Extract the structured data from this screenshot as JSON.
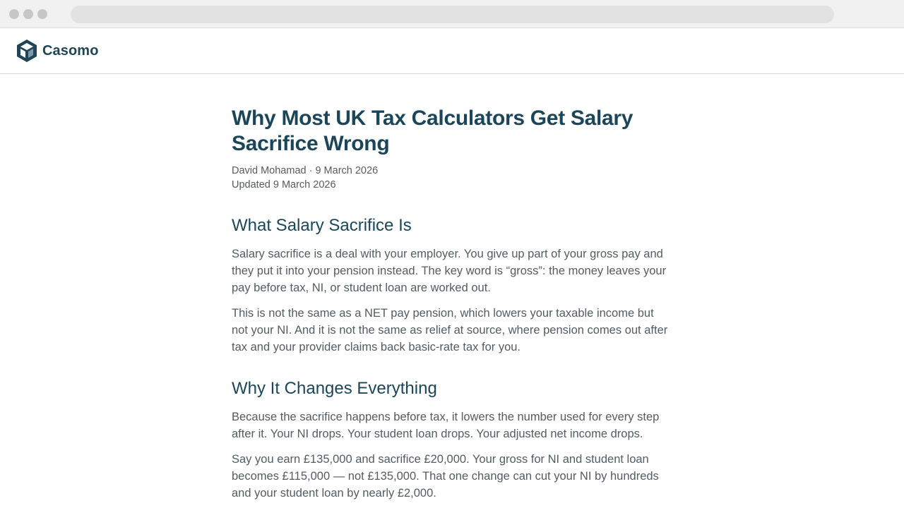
{
  "header": {
    "logo_text": "Casomo",
    "logo_icon": "cube-logo-icon",
    "brand_color": "#1f4556"
  },
  "article": {
    "title": "Why Most UK Tax Calculators Get Salary Sacrifice Wrong",
    "byline": "David Mohamad · 9 March 2026",
    "updated": "Updated 9 March 2026",
    "sections": [
      {
        "heading": "What Salary Sacrifice Is",
        "paragraphs": [
          "Salary sacrifice is a deal with your employer. You give up part of your gross pay and they put it into your pension instead. The key word is “gross”: the money leaves your pay before tax, NI, or student loan are worked out.",
          "This is not the same as a NET pay pension, which lowers your taxable income but not your NI. And it is not the same as relief at source, where pension comes out after tax and your provider claims back basic-rate tax for you."
        ]
      },
      {
        "heading": "Why It Changes Everything",
        "paragraphs": [
          "Because the sacrifice happens before tax, it lowers the number used for every step after it. Your NI drops. Your student loan drops. Your adjusted net income drops.",
          "Say you earn £135,000 and sacrifice £20,000. Your gross for NI and student loan becomes £115,000 — not £135,000. That one change can cut your NI by hundreds and your student loan by nearly £2,000."
        ]
      }
    ]
  }
}
